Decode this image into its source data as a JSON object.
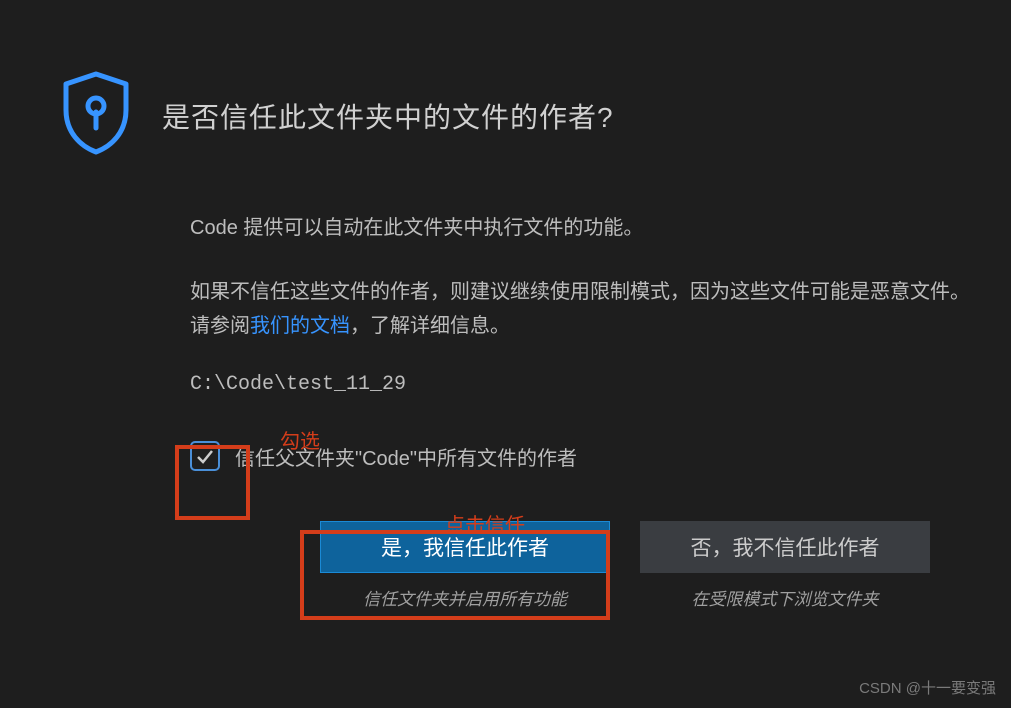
{
  "dialog": {
    "title": "是否信任此文件夹中的文件的作者?",
    "paragraph1": "Code 提供可以自动在此文件夹中执行文件的功能。",
    "paragraph2_pre": "如果不信任这些文件的作者，则建议继续使用限制模式，因为这些文件可能是恶意文件。请参阅",
    "paragraph2_link": "我们的文档",
    "paragraph2_post": "，了解详细信息。",
    "path": "C:\\Code\\test_11_29",
    "checkbox_label": "信任父文件夹\"Code\"中所有文件的作者",
    "checkbox_checked": true,
    "trust_button": "是，我信任此作者",
    "trust_sub": "信任文件夹并启用所有功能",
    "no_trust_button": "否，我不信任此作者",
    "no_trust_sub": "在受限模式下浏览文件夹"
  },
  "annotations": {
    "check": "勾选",
    "trust": "点击信任"
  },
  "watermark": "CSDN @十一要变强"
}
